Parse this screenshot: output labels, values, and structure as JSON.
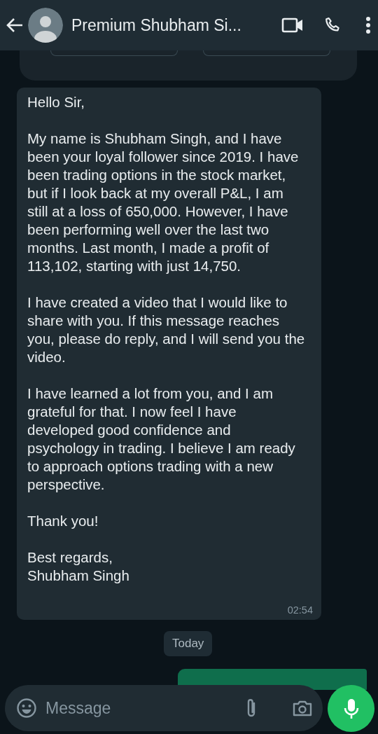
{
  "header": {
    "title": "Premium Shubham Si..."
  },
  "message": {
    "paragraphs": [
      "Hello Sir,",
      "My name is Shubham Singh, and I have been your loyal follower since 2019. I have been trading options in the stock market, but if I look back at my overall P&L, I am still at a loss of 650,000. However, I have been performing well over the last two months. Last month, I made a profit of 113,102, starting with just 14,750.",
      "I have created a video that I would like to share with you. If this message reaches you, please do reply, and I will send you the video.",
      "I have learned a lot from you, and I am grateful for that. I now feel I have developed good confidence and psychology in trading. I believe I am ready to approach options trading with a new perspective.",
      "Thank you!",
      "Best regards,\nShubham Singh"
    ],
    "time": "02:54"
  },
  "date_chip": "Today",
  "composer": {
    "placeholder": "Message"
  }
}
